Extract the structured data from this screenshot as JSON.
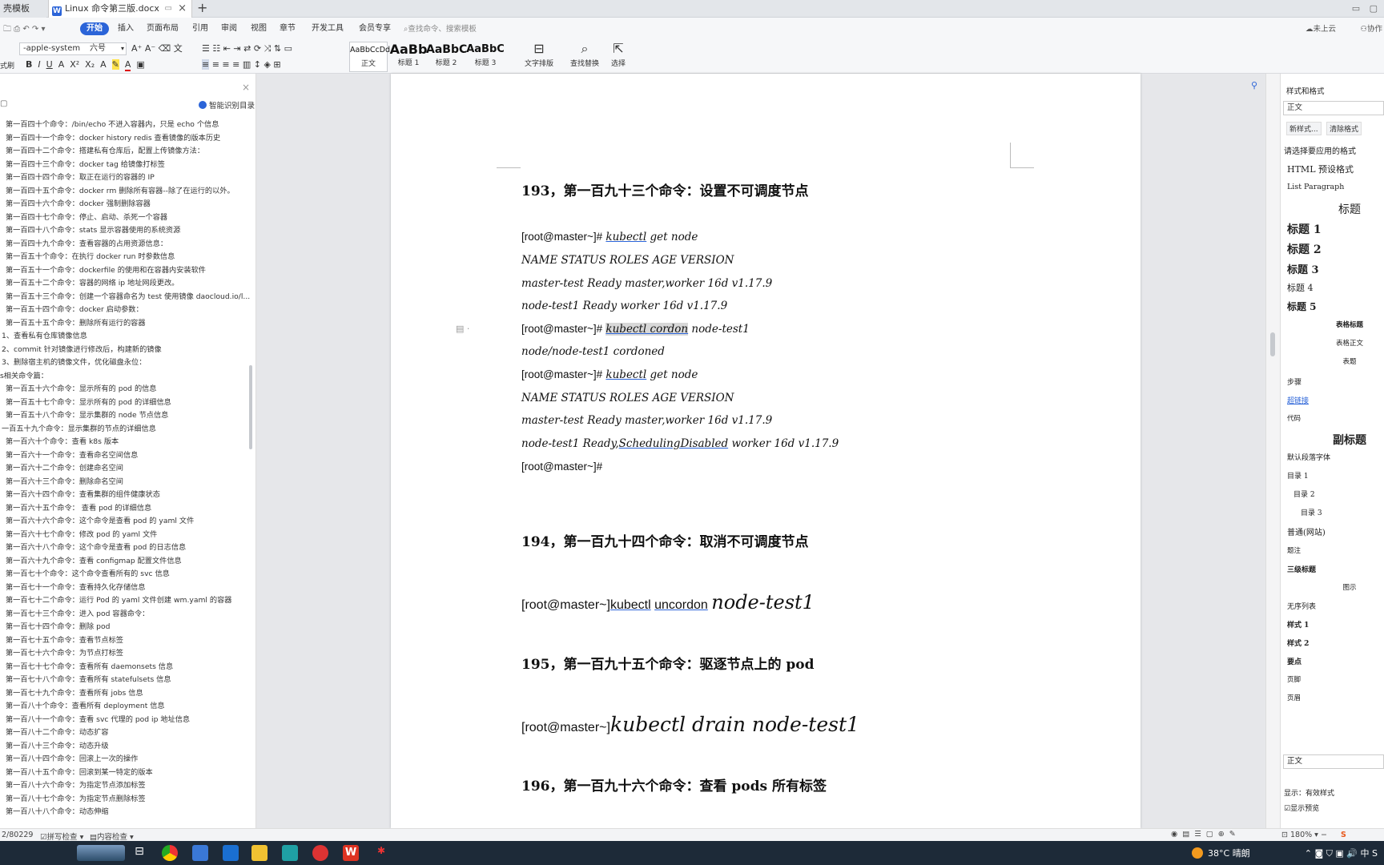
{
  "tabs": {
    "template_tab": "壳模板",
    "doc_tab": "Linux 命令第三版.docx",
    "new_tab": "+"
  },
  "ribbon": {
    "menus": [
      "开始",
      "插入",
      "页面布局",
      "引用",
      "审阅",
      "视图",
      "章节",
      "开发工具",
      "会员专享"
    ],
    "active_menu": "开始",
    "search_placeholder": "查找命令、搜索模板",
    "cloud_status": "未上云",
    "collab": "协作",
    "font_name": "-apple-system",
    "font_size": "六号",
    "styles": [
      {
        "preview": "AaBbCcDd",
        "label": "正文"
      },
      {
        "preview": "AaBb",
        "label": "标题 1"
      },
      {
        "preview": "AaBbC",
        "label": "标题 2"
      },
      {
        "preview": "AaBbC",
        "label": "标题 3"
      }
    ],
    "text_layout": "文字排版",
    "find_replace": "查找替换",
    "select": "选择",
    "clipboard_label": "式刷"
  },
  "nav": {
    "smart_dir": "智能识别目录",
    "items": [
      {
        "level": 2,
        "text": "第一百四十个命令：/bin/echo 不进入容器内，只是 echo 个信息"
      },
      {
        "level": 2,
        "text": "第一百四十一个命令：docker history redis 查看镜像的版本历史"
      },
      {
        "level": 2,
        "text": "第一百四十二个命令：搭建私有仓库后，配置上传镜像方法："
      },
      {
        "level": 2,
        "text": "第一百四十三个命令：docker tag 给镜像打标签"
      },
      {
        "level": 2,
        "text": "第一百四十四个命令：取正在运行的容器的 IP"
      },
      {
        "level": 2,
        "text": "第一百四十五个命令：docker rm 删除所有容器--除了在运行的以外。"
      },
      {
        "level": 2,
        "text": "第一百四十六个命令：docker 强制删除容器"
      },
      {
        "level": 2,
        "text": "第一百四十七个命令：停止、启动、杀死一个容器"
      },
      {
        "level": 2,
        "text": "第一百四十八个命令：stats 显示容器使用的系统资源"
      },
      {
        "level": 2,
        "text": "第一百四十九个命令：查看容器的占用资源信息："
      },
      {
        "level": 2,
        "text": "第一百五十个命令：在执行 docker run 时参数信息"
      },
      {
        "level": 2,
        "text": "第一百五十一个命令：dockerfile 的使用和在容器内安装软件"
      },
      {
        "level": 2,
        "text": "第一百五十二个命令：容器的网络 ip 地址网段更改。"
      },
      {
        "level": 2,
        "text": "第一百五十三个命令：创建一个容器命名为 test 使用镜像 daocloud.io/l..."
      },
      {
        "level": 2,
        "text": "第一百五十四个命令：docker 启动参数："
      },
      {
        "level": 2,
        "text": "第一百五十五个命令：删除所有运行的容器"
      },
      {
        "level": 1,
        "text": "1、查看私有仓库镜像信息"
      },
      {
        "level": 1,
        "text": "2、commit 针对镜像进行修改后，构建新的镜像"
      },
      {
        "level": 1,
        "text": "3、删除宿主机的镜像文件，优化磁盘永位："
      },
      {
        "level": 0,
        "text": "s相关命令篇："
      },
      {
        "level": 2,
        "text": "第一百五十六个命令：显示所有的 pod 的信息"
      },
      {
        "level": 2,
        "text": "第一百五十七个命令：显示所有的 pod 的详细信息"
      },
      {
        "level": 2,
        "text": "第一百五十八个命令：显示集群的 node 节点信息"
      },
      {
        "level": 1,
        "text": "一百五十九个命令：显示集群的节点的详细信息"
      },
      {
        "level": 2,
        "text": "第一百六十个命令：查看 k8s 版本"
      },
      {
        "level": 2,
        "text": "第一百六十一个命令：查看命名空间信息"
      },
      {
        "level": 2,
        "text": "第一百六十二个命令：创建命名空间"
      },
      {
        "level": 2,
        "text": "第一百六十三个命令：删除命名空间"
      },
      {
        "level": 2,
        "text": "第一百六十四个命令：查看集群的组件健康状态"
      },
      {
        "level": 2,
        "text": "第一百六十五个命令：  查看 pod 的详细信息"
      },
      {
        "level": 2,
        "text": "第一百六十六个命令：这个命令是查看 pod 的 yaml 文件"
      },
      {
        "level": 2,
        "text": "第一百六十七个命令：修改 pod 的 yaml 文件"
      },
      {
        "level": 2,
        "text": "第一百六十八个命令：这个命令是查看 pod 的日志信息"
      },
      {
        "level": 2,
        "text": "第一百六十九个命令：查看 configmap 配置文件信息"
      },
      {
        "level": 2,
        "text": "第一百七十个命令：这个命令查看所有的 svc 信息"
      },
      {
        "level": 2,
        "text": "第一百七十一个命令：查看持久化存储信息"
      },
      {
        "level": 2,
        "text": "第一百七十二个命令：运行 Pod 的 yaml 文件创建 wm.yaml 的容器"
      },
      {
        "level": 2,
        "text": "第一百七十三个命令：进入 pod 容器命令："
      },
      {
        "level": 2,
        "text": "第一百七十四个命令：删除 pod"
      },
      {
        "level": 2,
        "text": "第一百七十五个命令：查看节点标签"
      },
      {
        "level": 2,
        "text": "第一百七十六个命令：为节点打标签"
      },
      {
        "level": 2,
        "text": "第一百七十七个命令：查看所有 daemonsets 信息"
      },
      {
        "level": 2,
        "text": "第一百七十八个命令：查看所有 statefulsets 信息"
      },
      {
        "level": 2,
        "text": "第一百七十九个命令：查看所有 jobs 信息"
      },
      {
        "level": 2,
        "text": "第一百八十个命令：查看所有 deployment 信息"
      },
      {
        "level": 2,
        "text": "第一百八十一个命令：查看 svc 代理的 pod ip 地址信息"
      },
      {
        "level": 2,
        "text": "第一百八十二个命令：动态扩容"
      },
      {
        "level": 2,
        "text": "第一百八十三个命令：动态升级"
      },
      {
        "level": 2,
        "text": "第一百八十四个命令：回滚上一次的操作"
      },
      {
        "level": 2,
        "text": "第一百八十五个命令：回滚到某一特定的版本"
      },
      {
        "level": 2,
        "text": "第一百八十六个命令：为指定节点添加标签"
      },
      {
        "level": 2,
        "text": "第一百八十七个命令：为指定节点删除标签"
      },
      {
        "level": 2,
        "text": "第一百八十八个命令：动态伸缩"
      }
    ]
  },
  "doc": {
    "h193": "193，第一百九十三个命令：设置不可调度节点",
    "l1_prompt": "[root@master~]#",
    "l1_kubectl": "kubectl",
    "l1_rest": " get node",
    "l2": "NAME STATUS ROLES AGE VERSION",
    "l3": "master-test Ready master,worker 16d v1.17.9",
    "l4": "node-test1 Ready worker 16d v1.17.9",
    "l5_prompt": "[root@master~]#",
    "l5_sel": "kubectl cordon",
    "l5_rest": " node-test1",
    "l6": "node/node-test1 cordoned",
    "l7_prompt": "[root@master~]#",
    "l7_kubectl": "kubectl",
    "l7_rest": " get node",
    "l8": "NAME STATUS ROLES AGE VERSION",
    "l9": "master-test Ready master,worker 16d v1.17.9",
    "l10_a": "node-test1 Ready,",
    "l10_sd": "SchedulingDisabled",
    "l10_b": " worker 16d v1.17.9",
    "l11": "[root@master~]#",
    "h194": "194，第一百九十四个命令：取消不可调度节点",
    "c194_prompt": "[root@master~]",
    "c194_kubectl": "kubectl",
    "c194_uncordon": "uncordon",
    "c194_node": "node-test1",
    "h195": "195，第一百九十五个命令：驱逐节点上的 pod",
    "c195_prompt": "[root@master~]",
    "c195_cmd": "kubectl drain node-test1",
    "h196": "196，第一百九十六个命令：查看 pods 所有标签"
  },
  "style_panel": {
    "title": "样式和格式",
    "current": "正文",
    "new_style": "新样式...",
    "clear": "清除格式",
    "prompt": "请选择要应用的格式",
    "items": [
      {
        "text": "HTML 预设格式",
        "size": 11,
        "bold": false,
        "align": "left"
      },
      {
        "text": "List Paragraph",
        "size": 9.5,
        "bold": false,
        "align": "left"
      },
      {
        "text": "标题",
        "size": 14,
        "bold": false,
        "align": "center"
      },
      {
        "text": "标题 1",
        "size": 14,
        "bold": true,
        "align": "left"
      },
      {
        "text": "标题 2",
        "size": 14,
        "bold": true,
        "align": "left"
      },
      {
        "text": "标题 3",
        "size": 13,
        "bold": true,
        "align": "left"
      },
      {
        "text": "标题 4",
        "size": 11,
        "bold": false,
        "align": "left"
      },
      {
        "text": "标题 5",
        "size": 12,
        "bold": true,
        "align": "left"
      },
      {
        "text": "表格标题",
        "size": 8.5,
        "bold": true,
        "align": "center"
      },
      {
        "text": "表格正文",
        "size": 8.5,
        "bold": false,
        "align": "center"
      },
      {
        "text": "表题",
        "size": 8.5,
        "bold": false,
        "align": "center"
      },
      {
        "text": "步骤",
        "size": 9,
        "bold": false,
        "align": "left"
      },
      {
        "text": "超链接",
        "size": 9,
        "bold": false,
        "align": "left",
        "link": true
      },
      {
        "text": "代码",
        "size": 8.5,
        "bold": false,
        "align": "left"
      },
      {
        "text": "副标题",
        "size": 14,
        "bold": true,
        "align": "center"
      },
      {
        "text": "默认段落字体",
        "size": 9,
        "bold": false,
        "align": "left"
      },
      {
        "text": "目录 1",
        "size": 9,
        "bold": false,
        "align": "left"
      },
      {
        "text": "目录 2",
        "size": 9,
        "bold": false,
        "align": "indent1"
      },
      {
        "text": "目录 3",
        "size": 9,
        "bold": false,
        "align": "indent2"
      },
      {
        "text": "普通(网站)",
        "size": 10,
        "bold": false,
        "align": "left"
      },
      {
        "text": "题注",
        "size": 8.5,
        "bold": false,
        "align": "left"
      },
      {
        "text": "三级标题",
        "size": 9,
        "bold": true,
        "align": "left"
      },
      {
        "text": "图示",
        "size": 8.5,
        "bold": false,
        "align": "center"
      },
      {
        "text": "无序列表",
        "size": 9,
        "bold": false,
        "align": "left"
      },
      {
        "text": "样式 1",
        "size": 9,
        "bold": true,
        "align": "left"
      },
      {
        "text": "样式 2",
        "size": 9,
        "bold": true,
        "align": "left"
      },
      {
        "text": "要点",
        "size": 9,
        "bold": true,
        "align": "left"
      },
      {
        "text": "页脚",
        "size": 8.5,
        "bold": false,
        "align": "left"
      },
      {
        "text": "页眉",
        "size": 8.5,
        "bold": false,
        "align": "left"
      }
    ],
    "bottom_input": "正文",
    "show_label": "显示：",
    "show_value": "有效样式",
    "preview_label": "显示预览"
  },
  "status": {
    "pages": "2/80229",
    "spell": "拼写检查",
    "content": "内容检查",
    "zoom": "180%"
  },
  "taskbar": {
    "temp": "38°C",
    "weather": "晴朗",
    "ime": "中"
  }
}
